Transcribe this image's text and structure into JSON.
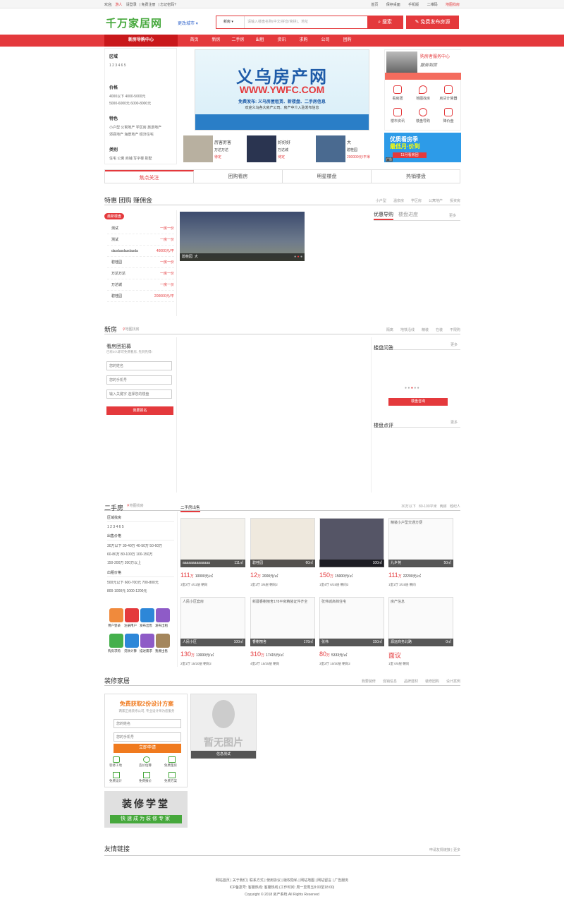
{
  "topbar": {
    "welcome": "欢迎,",
    "user": "游人",
    "login": "请登录",
    "register": "免费注册",
    "forgot": "忘记密码?",
    "right": [
      "首页",
      "保存桌面",
      "手机版",
      "二维码",
      "地图找房"
    ]
  },
  "header": {
    "logo": "千万家居网",
    "city": "更改城市",
    "search_type": "新房",
    "search_placeholder": "请输入楼盘名称(中文/拼音/简拼)、地址",
    "search_button": "搜索",
    "publish_button": "免费发布房源"
  },
  "nav": {
    "home": "新房导购中心",
    "items": [
      "首页",
      "新房",
      "二手房",
      "出租",
      "资讯",
      "求购",
      "公司",
      "团购"
    ]
  },
  "filter": {
    "area_title": "区域",
    "area_items": "1  2  3  4 6  5",
    "price_title": "价格",
    "price_line1": "4000以下   4000-5000元",
    "price_line2": "5000-6000元   6000-8000元",
    "feature_title": "特色",
    "feature_line1": "小户型  公寓地产  学区房  旅游地产",
    "feature_line2": "郊县地产  海景地产  经济住宅",
    "type_title": "类别",
    "type_line": "住宅  公寓  商铺  写字楼  别墅"
  },
  "banner": {
    "title": "义乌房产网",
    "url": "WWW.YWFC.COM",
    "sub1": "免费发布: 义乌房屋租赁、新楼盘、二手房信息",
    "sub2": "欢迎义乌各大房产公司、房产中介入驻发布信息"
  },
  "thumbs": [
    {
      "name": "厉害厉害",
      "sub": "万达万达",
      "price": "待定"
    },
    {
      "name": "好好好",
      "sub": "万达城",
      "price": "待定"
    },
    {
      "name": "大",
      "sub": "碧桂园",
      "price": "200000元/平米"
    }
  ],
  "service": {
    "title": "购房者服务中心",
    "slogan": "服务到房",
    "items": [
      "看房团",
      "地图找房",
      "房贷计算器",
      "楼市资讯",
      "楼盘导购",
      "降价盘"
    ]
  },
  "ad": {
    "line1": "优质看房季",
    "line2": "最低月·价到",
    "button": "11月看房团",
    "tag": "广告"
  },
  "tabs": [
    "焦点关注",
    "团购看房",
    "明星楼盘",
    "热销楼盘"
  ],
  "special": {
    "title": "特惠 团购 赚佣金",
    "links": [
      "小户型",
      "温泉房",
      "学区房",
      "公寓地产",
      "投资房"
    ],
    "badge": "最新楼盘",
    "list": [
      {
        "name": "测试",
        "price": "一房一价"
      },
      {
        "name": "测试",
        "price": "一房一价"
      },
      {
        "name": "dasdasdasdasda",
        "price": "40000元/平"
      },
      {
        "name": "碧桂园",
        "price": "一房一价"
      },
      {
        "name": "万达万达",
        "price": "一房一价"
      },
      {
        "name": "万达城",
        "price": "一房一价"
      },
      {
        "name": "碧桂园",
        "price": "200000元/平"
      }
    ],
    "slide_caption": "碧桂园",
    "slide_caption2": "大",
    "side_tab1": "优惠导购",
    "side_tab2": "楼盘进度",
    "side_more": "更多"
  },
  "newhouse": {
    "title": "新房",
    "map": "地图找房",
    "links": [
      "隔离",
      "地铁沿线",
      "精装",
      "在装",
      "不限购"
    ],
    "tuan_title": "看房团招募",
    "tuan_sub": "已有0人即可免费看房, 先到先得!",
    "name_ph": "您的姓名",
    "phone_ph": "您的手机号",
    "keyword_ph": "输入关键字 选择您的楼盘",
    "submit": "我要报名",
    "qa_title": "楼盘问答",
    "qa_more": "更多",
    "qa_button": "楼盘咨询",
    "review_title": "楼盘点评",
    "review_more": "更多"
  },
  "second": {
    "title": "二手房",
    "map": "地图找房",
    "tab": "二手房出售",
    "links": [
      "30万以下",
      "80-100平米",
      "两房",
      "经纪人"
    ],
    "area_title": "区域找房",
    "area_items": "1  2  3  4 6  5",
    "price_title": "出售价格",
    "price_l1": "30万以下   30-40万   40-50万   50-60万",
    "price_l2": "60-80万   80-100万   100-150万",
    "price_l3": "150-200万   200万以上",
    "rent_title": "出租价格",
    "rent_l1": "500元以下   600-700元   700-800元",
    "rent_l2": "800-1000元   1000-1200元",
    "icons": [
      "用户登录",
      "注册用户",
      "发布出售",
      "发布出租",
      "购房求购",
      "贷款计算",
      "描述需求",
      "我要出售"
    ],
    "items": [
      {
        "img": "",
        "name": "aaaaaaaaaaaaaa",
        "area": "111㎡",
        "price": "111",
        "unit": "万",
        "up": "10000元/㎡",
        "desc": "3室2厅 4/11层 朝向"
      },
      {
        "img": "",
        "name": "碧桂园",
        "area": "60㎡",
        "price": "12",
        "unit": "万",
        "up": "2000元/㎡",
        "desc": "1室1厅 3/6层 朝向2"
      },
      {
        "img": "",
        "name": "",
        "area": "100㎡",
        "price": "150",
        "unit": "万",
        "up": "15000元/㎡",
        "desc": "1室4厅 6/15层 朝向3"
      },
      {
        "img": "精装小户型交通方便",
        "name": "九乡苑",
        "area": "50㎡",
        "price": "111",
        "unit": "万",
        "up": "22200元/㎡",
        "desc": "1室1厅 3/15层 朝向"
      },
      {
        "img": "人民小区套房",
        "name": "人民小区",
        "area": "100㎡",
        "price": "130",
        "unit": "万",
        "up": "13000元/㎡",
        "desc": "2室1厅 15/20层 朝向2"
      },
      {
        "img": "新疆香榭丽舍178平房精装证件齐全",
        "name": "香榭丽舍",
        "area": "178㎡",
        "price": "310",
        "unit": "万",
        "up": "17415元/㎡",
        "desc": "4室2厅 15/25层 朝向"
      },
      {
        "img": "张伟城高档住宅",
        "name": "张伟",
        "area": "150㎡",
        "price": "80",
        "unit": "万",
        "up": "5333元/㎡",
        "desc": "3室2厅 10/30层 朝向2"
      },
      {
        "img": "房产信息",
        "name": "源远商务北路",
        "area": "0㎡",
        "price": "面议",
        "unit": "",
        "up": "",
        "desc": "1室 0/0层 朝向"
      }
    ]
  },
  "deco": {
    "title": "装修家居",
    "links": [
      "我要装修",
      "促销信息",
      "品牌建材",
      "装修团购",
      "设计案例"
    ],
    "promo_title": "免费获取2份设计方案",
    "promo_sub": "两家正规装修公司, 专业设计师为您服务",
    "name_ph": "您的姓名",
    "phone_ph": "您的手机号",
    "apply": "立即申请",
    "small": [
      "装修工地",
      "造价估算",
      "免费量房",
      "免费设计",
      "免费报价",
      "免费方案"
    ],
    "school_title": "装修学堂",
    "school_sub": "快速成为装修专家",
    "nopic": "暂无图片",
    "nopic_cap": "信息测试"
  },
  "links_section": {
    "title": "友情链接",
    "apply": "申请友情链接",
    "more": "更多"
  },
  "footer": {
    "links": "网站首页 | 关于我们 | 联系方式 | 使用协议 | 版权隐私 | 网站地图 | 网站留言 | 广告服务",
    "icp": "ICP备案号: 客服热线: 客服热线 (工作时间: 周一至周五8:00至18:00)",
    "copy": "Copyright © 2018 房产系统 All Rights Reserved"
  }
}
